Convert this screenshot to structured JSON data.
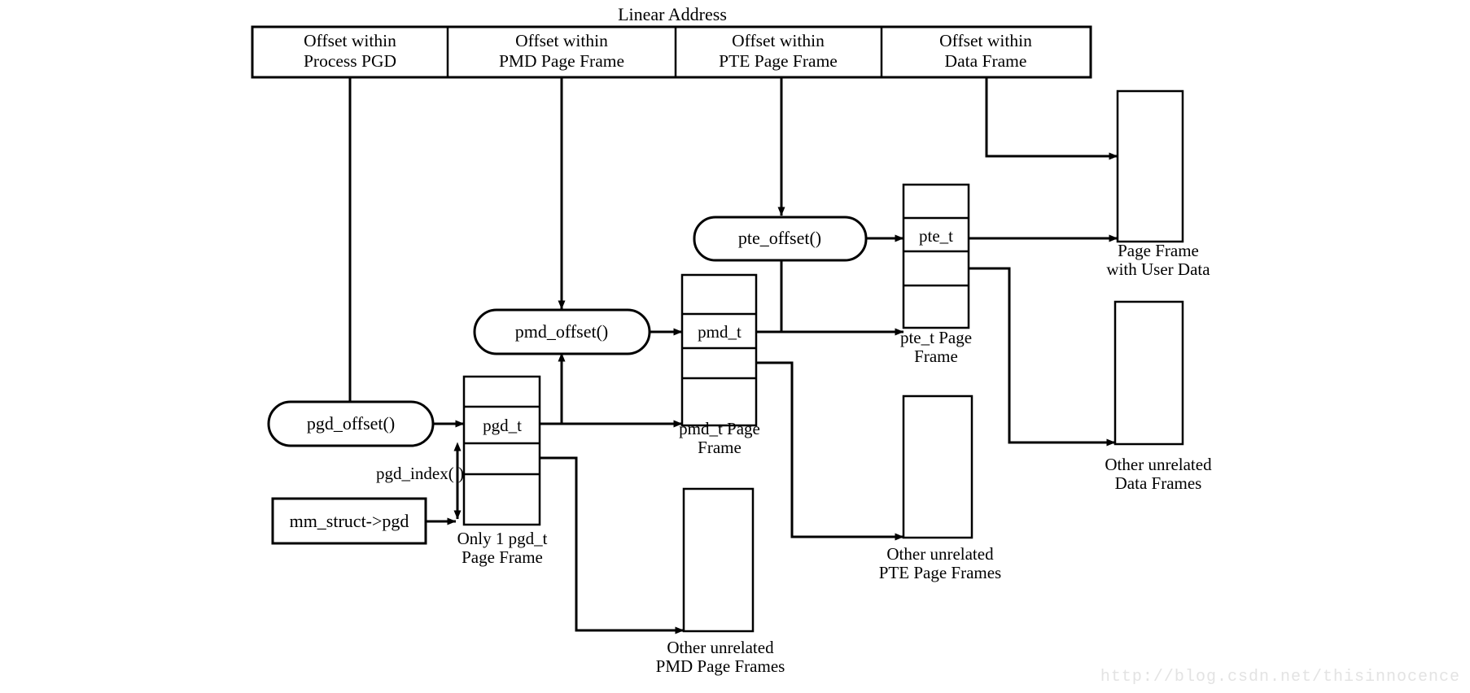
{
  "diagram": {
    "title": "Linear Address",
    "watermark": "http://blog.csdn.net/thisinnocence",
    "address_fields": [
      {
        "line1": "Offset within",
        "line2": "Process PGD"
      },
      {
        "line1": "Offset within",
        "line2": "PMD Page Frame"
      },
      {
        "line1": "Offset within",
        "line2": "PTE Page Frame"
      },
      {
        "line1": "Offset within",
        "line2": "Data Frame"
      }
    ],
    "functions": {
      "pgd_offset": "pgd_offset()",
      "pmd_offset": "pmd_offset()",
      "pte_offset": "pte_offset()",
      "pgd_index": "pgd_index( )"
    },
    "struct_box": {
      "label": "mm_struct->pgd"
    },
    "frames": {
      "pgd": {
        "entry_label": "pgd_t",
        "caption_line1": "Only 1 pgd_t",
        "caption_line2": "Page Frame",
        "cells": 4
      },
      "pmd": {
        "entry_label": "pmd_t",
        "caption_line1": "pmd_t Page",
        "caption_line2": "Frame",
        "cells": 4
      },
      "pte": {
        "entry_label": "pte_t",
        "caption_line1": "pte_t Page",
        "caption_line2": "Frame",
        "cells": 4
      }
    },
    "data_frames": {
      "user_data": {
        "caption_line1": "Page Frame",
        "caption_line2": "with User Data"
      },
      "other_data": {
        "caption_line1": "Other unrelated",
        "caption_line2": "Data Frames"
      },
      "other_pte": {
        "caption_line1": "Other unrelated",
        "caption_line2": "PTE Page Frames"
      },
      "other_pmd": {
        "caption_line1": "Other unrelated",
        "caption_line2": "PMD Page Frames"
      }
    },
    "colors": {
      "stroke": "#000000",
      "fill": "#ffffff",
      "watermark": "#e3e3e3"
    }
  }
}
